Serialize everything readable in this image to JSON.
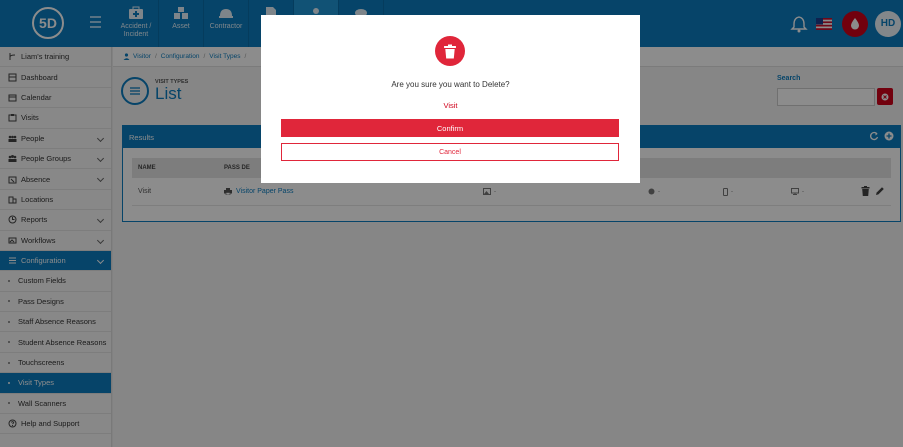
{
  "app": {
    "logo_text": "5D"
  },
  "topnav": [
    {
      "label": "Accident / Incident",
      "icon": "first-aid-icon",
      "active": false
    },
    {
      "label": "Asset",
      "icon": "boxes-icon",
      "active": false
    },
    {
      "label": "Contractor",
      "icon": "hard-hat-icon",
      "active": false
    },
    {
      "label": "",
      "icon": "document-icon",
      "active": false
    },
    {
      "label": "",
      "icon": "user-icon",
      "active": true
    },
    {
      "label": "",
      "icon": "visitor-icon",
      "active": false
    }
  ],
  "header": {
    "avatar_initials": "HD"
  },
  "sidebar": {
    "items": [
      {
        "label": "Liam's training",
        "icon": "branch-icon",
        "chevron": false
      },
      {
        "label": "Dashboard",
        "icon": "dashboard-icon",
        "chevron": false
      },
      {
        "label": "Calendar",
        "icon": "calendar-icon",
        "chevron": false
      },
      {
        "label": "Visits",
        "icon": "visits-icon",
        "chevron": false
      },
      {
        "label": "People",
        "icon": "people-icon",
        "chevron": true
      },
      {
        "label": "People Groups",
        "icon": "groups-icon",
        "chevron": true
      },
      {
        "label": "Absence",
        "icon": "absence-icon",
        "chevron": true
      },
      {
        "label": "Locations",
        "icon": "locations-icon",
        "chevron": false
      },
      {
        "label": "Reports",
        "icon": "reports-icon",
        "chevron": true
      },
      {
        "label": "Workflows",
        "icon": "workflows-icon",
        "chevron": true
      },
      {
        "label": "Configuration",
        "icon": "configuration-icon",
        "chevron": true,
        "active": true
      }
    ],
    "subitems": [
      {
        "label": "Custom Fields"
      },
      {
        "label": "Pass Designs"
      },
      {
        "label": "Staff Absence Reasons"
      },
      {
        "label": "Student Absence Reasons"
      },
      {
        "label": "Touchscreens"
      },
      {
        "label": "Visit Types",
        "active": true
      },
      {
        "label": "Wall Scanners"
      }
    ],
    "help": {
      "label": "Help and Support"
    }
  },
  "breadcrumb": {
    "items": [
      "Visitor",
      "Configuration",
      "Visit Types"
    ]
  },
  "page": {
    "subtitle": "VISIT TYPES",
    "title": "List"
  },
  "search": {
    "label": "Search",
    "placeholder": ""
  },
  "results": {
    "title": "Results",
    "columns": [
      "NAME",
      "PASS DE"
    ],
    "rows": [
      {
        "name": "Visit",
        "pass_design": "Visitor Paper Pass",
        "c1": "-",
        "c2": "-",
        "c3": "-",
        "c4": "-"
      }
    ]
  },
  "modal": {
    "message": "Are you sure you want to Delete?",
    "item": "Visit",
    "confirm_label": "Confirm",
    "cancel_label": "Cancel"
  },
  "colors": {
    "primary": "#0b7dc0",
    "danger": "#e0263a",
    "brand_red": "#d0021b"
  }
}
